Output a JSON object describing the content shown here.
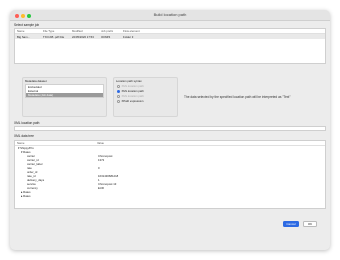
{
  "window": {
    "title": "Build location path"
  },
  "sample": {
    "label": "Select sample job",
    "columns": [
      "Name",
      "File Type",
      "Modified",
      "Job prefix",
      "Flow element"
    ],
    "rows": [
      {
        "name": "Big Sam...",
        "type": "TXO-KB  .pdf File",
        "modified": "22/05/2020 17:53",
        "prefix": "O0NP4",
        "flow": "Folder 3"
      }
    ]
  },
  "dataset": {
    "label": "Metadata dataset",
    "items": [
      "Embedded",
      "External",
      "Metadata (Job data)"
    ],
    "selected_index": 2
  },
  "location": {
    "label": "Location path syntax",
    "options": [
      {
        "label": "XML location path",
        "enabled": true
      },
      {
        "label": "XML location path",
        "enabled": true,
        "selected": true
      },
      {
        "label": "XML location path",
        "enabled": false
      },
      {
        "label": "XPath expression",
        "enabled": true
      }
    ],
    "hint": "The data selected by the specified location path will be interpreted as \"Text\""
  },
  "xml_location": {
    "label": "XML location path",
    "value": ""
  },
  "tree": {
    "label": "XML data tree",
    "columns": [
      "Name",
      "Value"
    ],
    "rows": [
      {
        "name": "▾ Shippy/Pro",
        "value": "",
        "indent": 0
      },
      {
        "name": "▾ Rates",
        "value": "",
        "indent": 1
      },
      {
        "name": "carrier",
        "value": "Chronopost",
        "indent": 3
      },
      {
        "name": "carrier_id",
        "value": "1372",
        "indent": 3
      },
      {
        "name": "carrier_label",
        "value": "",
        "indent": 3
      },
      {
        "name": "rate",
        "value": "0",
        "indent": 3
      },
      {
        "name": "order_id",
        "value": "",
        "indent": 3
      },
      {
        "name": "rate_id",
        "value": "1631430681218",
        "indent": 3
      },
      {
        "name": "delivery_days",
        "value": "1",
        "indent": 3
      },
      {
        "name": "service",
        "value": "Chronopost 13",
        "indent": 3
      },
      {
        "name": "currency",
        "value": "EUR",
        "indent": 3
      },
      {
        "name": "▸ Rates",
        "value": "",
        "indent": 1
      },
      {
        "name": "▸ Rates",
        "value": "",
        "indent": 1
      }
    ]
  },
  "buttons": {
    "cancel": "Cancel",
    "ok": "OK"
  },
  "colors": {
    "accent": "#2d6ae3"
  }
}
